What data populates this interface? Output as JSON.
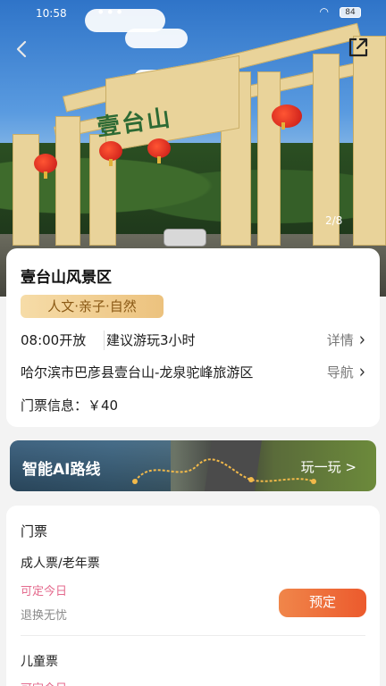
{
  "status_bar": {
    "time": "10:58",
    "battery": "84"
  },
  "hero": {
    "carved_text": "壹台山",
    "photo_counter": "2/8"
  },
  "scenic": {
    "title": "壹台山风景区",
    "tags": "人文·亲子·自然",
    "open_time": "08:00开放",
    "suggested_duration": "建议游玩3小时",
    "details_label": "详情",
    "address": "哈尔滨市巴彦县壹台山-龙泉驼峰旅游区",
    "navigate_label": "导航",
    "ticket_info": "门票信息：￥40"
  },
  "ai_route": {
    "title": "智能AI路线",
    "action": "玩一玩 >"
  },
  "tickets": {
    "heading": "门票",
    "items": [
      {
        "name": "成人票/老年票",
        "availability": "可定今日",
        "refund": "退换无忧",
        "book_label": "预定"
      },
      {
        "name": "儿童票",
        "availability": "可定今日"
      }
    ]
  },
  "colors": {
    "accent_orange": "#ec5a2d",
    "tag_gold": "#ecc27e",
    "availability_pink": "#e46a8d"
  }
}
